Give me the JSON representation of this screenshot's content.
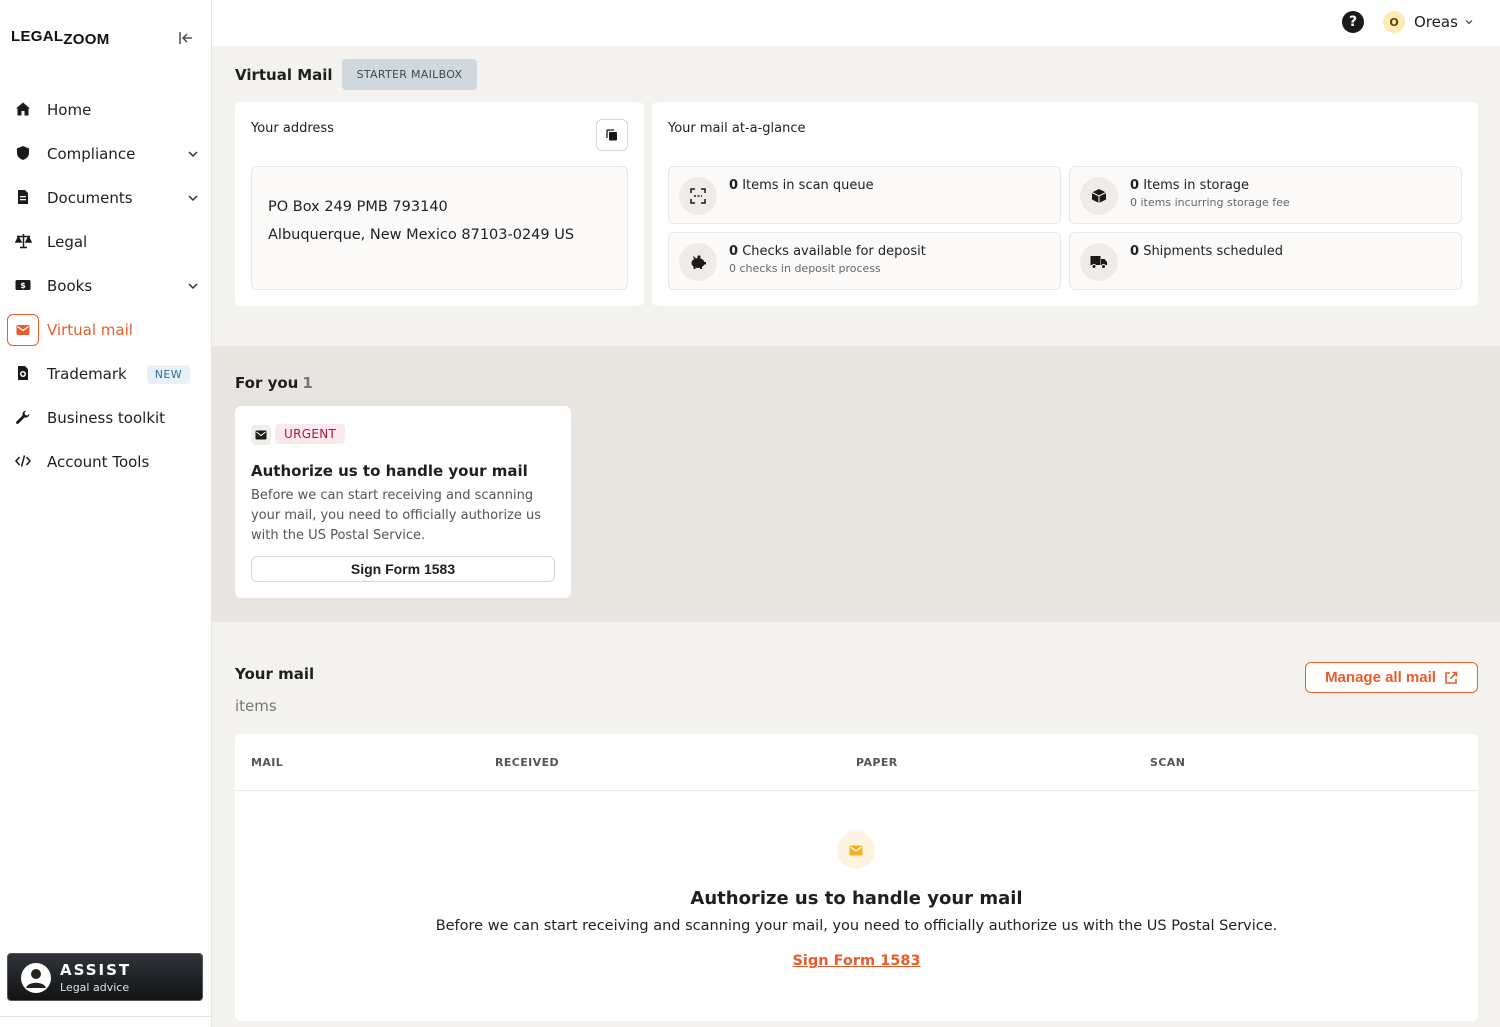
{
  "brand": {
    "legal": "LEGAL",
    "zoom": "ZOOM"
  },
  "sidebar": {
    "items": [
      {
        "label": "Home"
      },
      {
        "label": "Compliance"
      },
      {
        "label": "Documents"
      },
      {
        "label": "Legal"
      },
      {
        "label": "Books"
      },
      {
        "label": "Virtual mail"
      },
      {
        "label": "Trademark",
        "badge": "NEW"
      },
      {
        "label": "Business toolkit"
      },
      {
        "label": "Account Tools"
      }
    ],
    "assist": {
      "title": "ASSIST",
      "subtitle": "Legal advice"
    }
  },
  "header": {
    "help_label": "?",
    "user_initial": "O",
    "user_name": "Oreas"
  },
  "colors": {
    "accent": "#e85d2b",
    "urgent": "#a5193d"
  },
  "main": {
    "title": "Virtual Mail",
    "plan_badge": "STARTER MAILBOX",
    "address_card": {
      "label": "Your address",
      "line1": "PO Box 249 PMB 793140",
      "line2": "Albuquerque, New Mexico 87103-0249 US"
    },
    "glance": {
      "label": "Your mail at-a-glance",
      "tiles": [
        {
          "count": "0",
          "text": "Items in scan queue",
          "sub": "",
          "icon": "scan-icon"
        },
        {
          "count": "0",
          "text": "Items in storage",
          "sub": "0 items incurring storage fee",
          "icon": "box-icon"
        },
        {
          "count": "0",
          "text": "Checks available for deposit",
          "sub": "0 checks in deposit process",
          "icon": "piggy-bank-icon"
        },
        {
          "count": "0",
          "text": "Shipments scheduled",
          "sub": "",
          "icon": "truck-icon"
        }
      ]
    },
    "for_you": {
      "title": "For you",
      "count": "1",
      "task": {
        "tag": "URGENT",
        "title": "Authorize us to handle your mail",
        "description": "Before we can start receiving and scanning your mail, you need to officially authorize us with the US Postal Service.",
        "button": "Sign Form 1583"
      }
    },
    "your_mail": {
      "title": "Your mail",
      "subtitle": "items",
      "manage_button": "Manage all mail",
      "columns": [
        "MAIL",
        "RECEIVED",
        "PAPER",
        "SCAN"
      ],
      "empty_title": "Authorize us to handle your mail",
      "empty_description": "Before we can start receiving and scanning your mail, you need to officially authorize us with the US Postal Service.",
      "empty_link": "Sign Form 1583"
    }
  }
}
